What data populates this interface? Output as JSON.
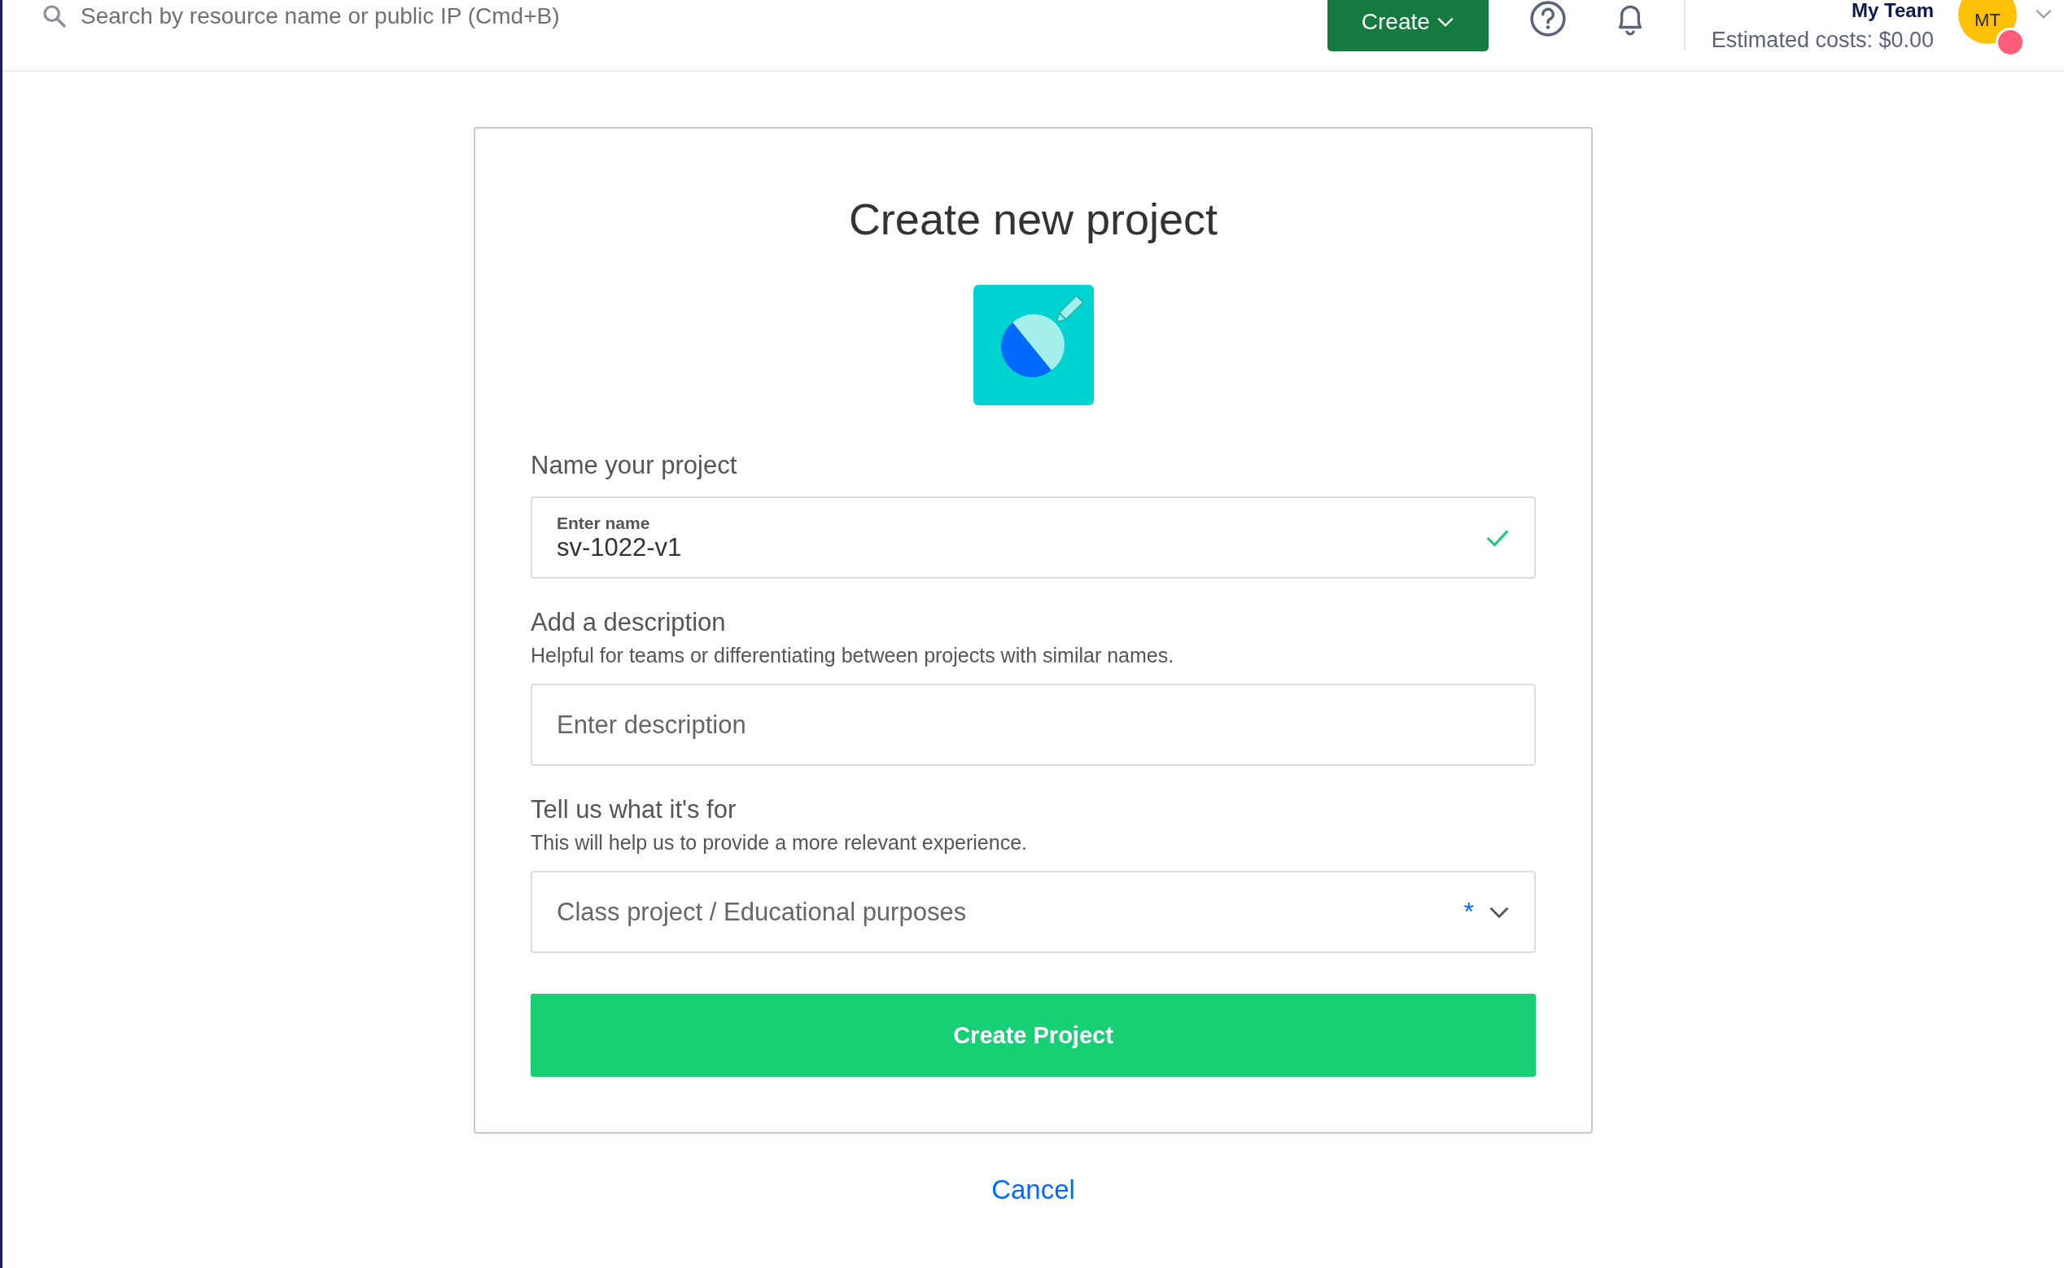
{
  "topbar": {
    "search": {
      "placeholder": "Search by resource name or public IP (Cmd+B)"
    },
    "create_button": "Create",
    "team": {
      "name": "My Team",
      "costs": "Estimated costs: $0.00"
    },
    "avatar": {
      "initials": "MT"
    }
  },
  "dialog": {
    "title": "Create new project",
    "fields": [
      {
        "kind": "text",
        "label": "Name your project",
        "floating_label": "Enter name",
        "value": "sv-1022-v1",
        "valid": true
      },
      {
        "kind": "text",
        "label": "Add a description",
        "hint": "Helpful for teams or differentiating between projects with similar names.",
        "placeholder": "Enter description"
      },
      {
        "kind": "select",
        "label": "Tell us what it's for",
        "hint": "This will help us to provide a more relevant experience.",
        "value": "Class project / Educational purposes",
        "required_mark": "*"
      }
    ],
    "submit": "Create Project"
  },
  "cancel": "Cancel"
}
